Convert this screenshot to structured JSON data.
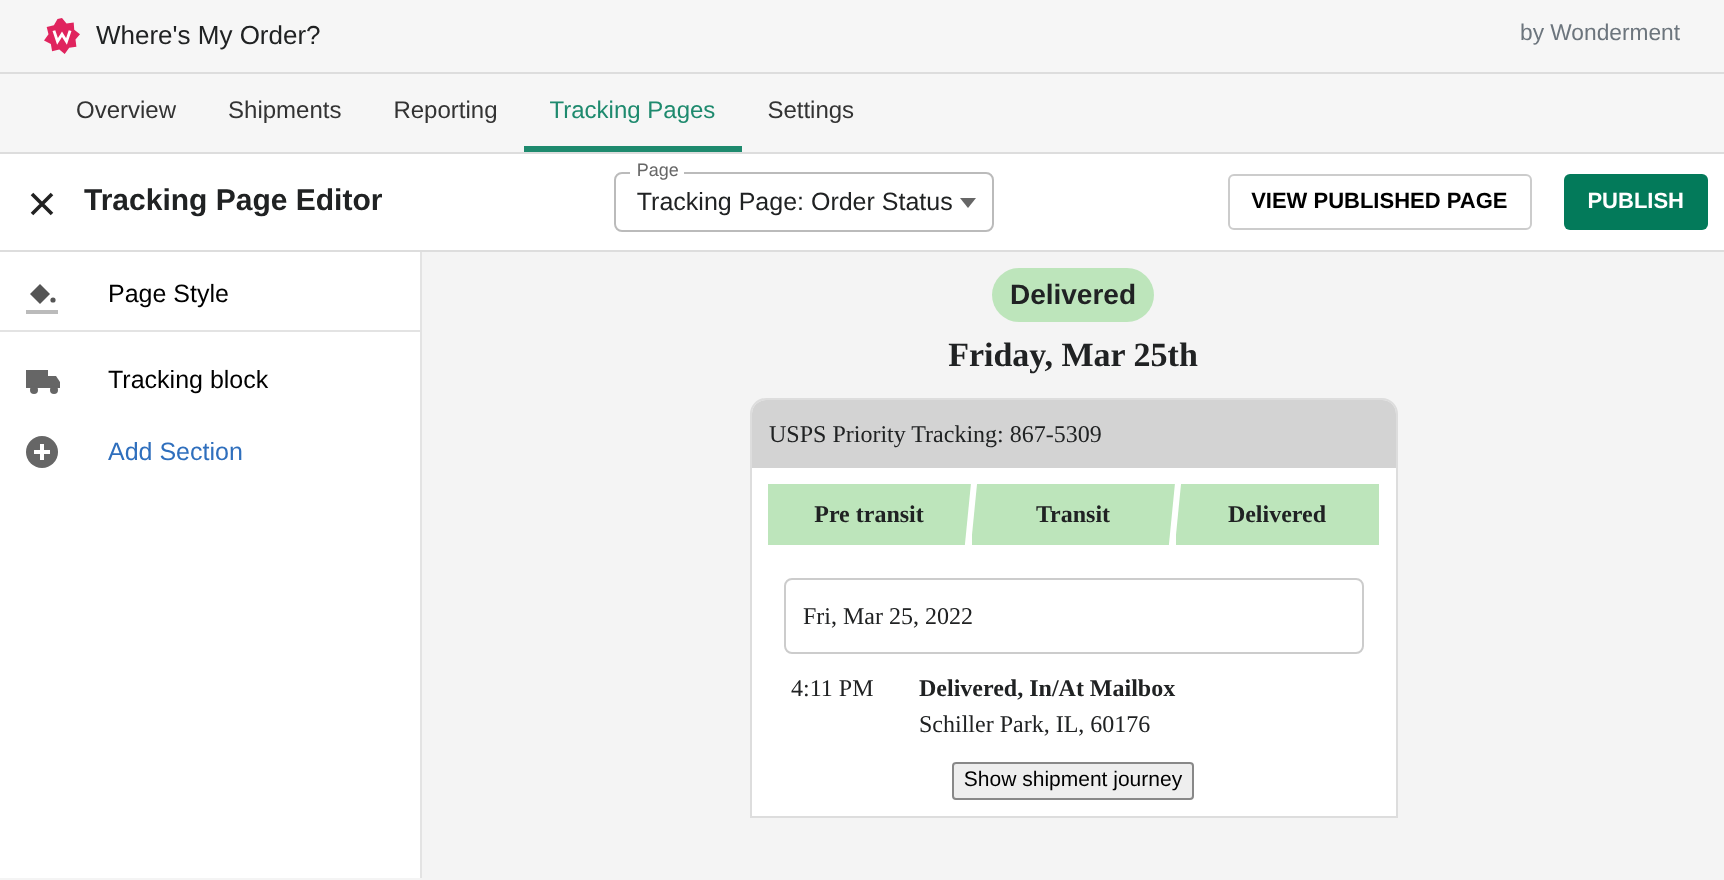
{
  "app": {
    "title": "Where's My Order?",
    "byline": "by Wonderment"
  },
  "tabs": [
    {
      "label": "Overview",
      "selected": false
    },
    {
      "label": "Shipments",
      "selected": false
    },
    {
      "label": "Reporting",
      "selected": false
    },
    {
      "label": "Tracking Pages",
      "selected": true
    },
    {
      "label": "Settings",
      "selected": false
    }
  ],
  "toolbar": {
    "title": "Tracking Page Editor",
    "page_select": {
      "label": "Page",
      "value": "Tracking Page: Order Status"
    },
    "buttons": [
      {
        "label": "VIEW PUBLISHED PAGE",
        "kind": "outline"
      },
      {
        "label": "PUBLISH",
        "kind": "primary"
      }
    ]
  },
  "sidebar": {
    "items": [
      {
        "label": "Page Style",
        "kind": "style"
      },
      {
        "label": "Tracking block",
        "kind": "block"
      },
      {
        "label": "Add Section",
        "kind": "add"
      }
    ]
  },
  "preview": {
    "status": "Delivered",
    "date": "Friday, Mar 25th",
    "carrier": "USPS Priority Tracking: 867-5309",
    "steps": [
      {
        "label": "Pre transit",
        "done": true
      },
      {
        "label": "Transit",
        "done": true
      },
      {
        "label": "Delivered",
        "done": true
      }
    ],
    "event_date": "Fri, Mar 25, 2022",
    "events": [
      {
        "time": "4:11 PM",
        "status": "Delivered, In/At Mailbox",
        "location": "Schiller Park, IL, 60176"
      }
    ],
    "journey_button": "Show shipment journey"
  }
}
